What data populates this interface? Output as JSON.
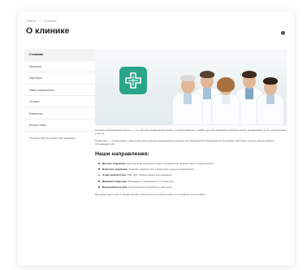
{
  "breadcrumb": [
    "Главная",
    "О клинике"
  ],
  "page_title": "О клинике",
  "sidebar": {
    "items": [
      {
        "label": "О клинике",
        "active": true
      },
      {
        "label": "Лицензии",
        "active": false
      },
      {
        "label": "Партнеры",
        "active": false
      },
      {
        "label": "Наши специалисты",
        "active": false
      },
      {
        "label": "Отзывы",
        "active": false
      },
      {
        "label": "Реквизиты",
        "active": false
      },
      {
        "label": "Вопрос-ответ",
        "active": false
      }
    ],
    "note": "Лечение зуба не опасно для здоровья"
  },
  "hero": {
    "logo_icon": "medical-cross-icon",
    "brand_color": "#2ba58a"
  },
  "content": {
    "intro": "Клиника «Медицинский центр» — это частный медицинский центр, который работает с 2006 года. Мы оказываем широкий спектр медицинских услуг для взрослых и детей.",
    "intro_2": "Наша цель — предоставить пациентам качественную медицинскую помощь на современном оборудовании. В клинике работают опытные врачи разных специальностей.",
    "section_title": "Наши направления:",
    "directions": [
      {
        "title": "Детское отделение.",
        "text": "Консультации педиатра и узких специалистов, диагностика и лечение детей."
      },
      {
        "title": "Взрослое отделение.",
        "text": "Терапия, кардиология, неврология и другие направления."
      },
      {
        "title": "Отдел диагностики.",
        "text": "УЗИ, ЭКГ, лабораторные исследования."
      },
      {
        "title": "Дневной стационар.",
        "text": "Процедуры и наблюдение в течение дня."
      },
      {
        "title": "Выезд врача на дом.",
        "text": "Консультация специалиста у вас дома."
      }
    ],
    "outro": "Мы рады видеть вас в нашей клинике. Записаться на приём можно по телефону или на сайте."
  }
}
